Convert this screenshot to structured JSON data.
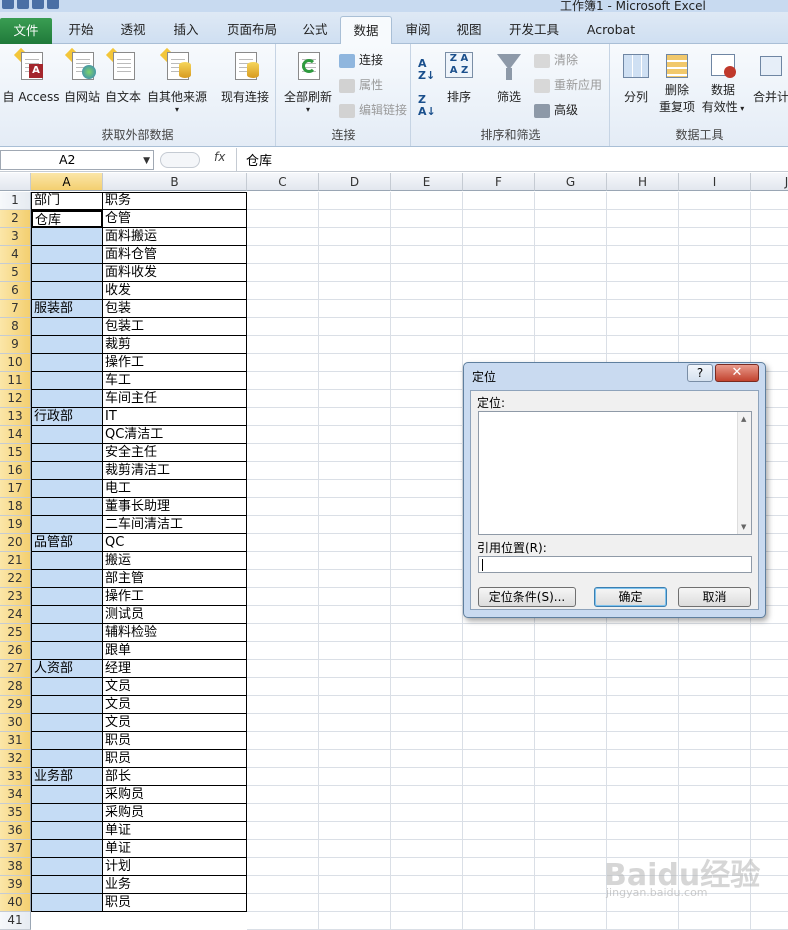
{
  "window": {
    "title": "工作簿1 - Microsoft Excel"
  },
  "tabs": [
    "文件",
    "开始",
    "插入",
    "页面布局",
    "公式",
    "数据",
    "审阅",
    "视图",
    "开发工具",
    "Acrobat"
  ],
  "tabs_display": [
    "文件",
    "开始",
    "透视",
    "插入",
    "页面布局",
    "公式",
    "数据",
    "审阅",
    "视图",
    "开发工具",
    "Acrobat"
  ],
  "active_tab": "数据",
  "ribbon": {
    "external": {
      "label": "获取外部数据",
      "access": "自 Access",
      "web": "自网站",
      "text": "自文本",
      "other": "自其他来源",
      "existing": "现有连接"
    },
    "connections": {
      "label": "连接",
      "refresh_all": "全部刷新",
      "connections": "连接",
      "properties": "属性",
      "edit_links": "编辑链接"
    },
    "sort": {
      "label": "排序和筛选",
      "sort": "排序",
      "filter": "筛选",
      "clear": "清除",
      "reapply": "重新应用",
      "advanced": "高级"
    },
    "tools": {
      "label": "数据工具",
      "split": "分列",
      "remove_dup_1": "删除",
      "remove_dup_2": "重复项",
      "validation_1": "数据",
      "validation_2": "有效性",
      "consolidate": "合并计"
    }
  },
  "formula_bar": {
    "name_box": "A2",
    "fx": "fx",
    "value": "仓库"
  },
  "columns": [
    "A",
    "B",
    "C",
    "D",
    "E",
    "F",
    "G",
    "H",
    "I",
    "J"
  ],
  "rows": [
    {
      "n": "1",
      "a": "部门",
      "b": "职务"
    },
    {
      "n": "2",
      "a": "仓库",
      "b": "仓管"
    },
    {
      "n": "3",
      "a": "",
      "b": "面料搬运"
    },
    {
      "n": "4",
      "a": "",
      "b": "面料仓管"
    },
    {
      "n": "5",
      "a": "",
      "b": "面料收发"
    },
    {
      "n": "6",
      "a": "",
      "b": "收发"
    },
    {
      "n": "7",
      "a": "服装部",
      "b": "包装"
    },
    {
      "n": "8",
      "a": "",
      "b": "包装工"
    },
    {
      "n": "9",
      "a": "",
      "b": "裁剪"
    },
    {
      "n": "10",
      "a": "",
      "b": "操作工"
    },
    {
      "n": "11",
      "a": "",
      "b": "车工"
    },
    {
      "n": "12",
      "a": "",
      "b": "车间主任"
    },
    {
      "n": "13",
      "a": "行政部",
      "b": "IT"
    },
    {
      "n": "14",
      "a": "",
      "b": "QC清洁工"
    },
    {
      "n": "15",
      "a": "",
      "b": "安全主任"
    },
    {
      "n": "16",
      "a": "",
      "b": "裁剪清洁工"
    },
    {
      "n": "17",
      "a": "",
      "b": "电工"
    },
    {
      "n": "18",
      "a": "",
      "b": "董事长助理"
    },
    {
      "n": "19",
      "a": "",
      "b": "二车间清洁工"
    },
    {
      "n": "20",
      "a": "品管部",
      "b": "QC"
    },
    {
      "n": "21",
      "a": "",
      "b": "搬运"
    },
    {
      "n": "22",
      "a": "",
      "b": "部主管"
    },
    {
      "n": "23",
      "a": "",
      "b": "操作工"
    },
    {
      "n": "24",
      "a": "",
      "b": "测试员"
    },
    {
      "n": "25",
      "a": "",
      "b": "辅料检验"
    },
    {
      "n": "26",
      "a": "",
      "b": "跟单"
    },
    {
      "n": "27",
      "a": "人资部",
      "b": "经理"
    },
    {
      "n": "28",
      "a": "",
      "b": "文员"
    },
    {
      "n": "29",
      "a": "",
      "b": "文员"
    },
    {
      "n": "30",
      "a": "",
      "b": "文员"
    },
    {
      "n": "31",
      "a": "",
      "b": "职员"
    },
    {
      "n": "32",
      "a": "",
      "b": "职员"
    },
    {
      "n": "33",
      "a": "业务部",
      "b": "部长"
    },
    {
      "n": "34",
      "a": "",
      "b": "采购员"
    },
    {
      "n": "35",
      "a": "",
      "b": "采购员"
    },
    {
      "n": "36",
      "a": "",
      "b": "单证"
    },
    {
      "n": "37",
      "a": "",
      "b": "单证"
    },
    {
      "n": "38",
      "a": "",
      "b": "计划"
    },
    {
      "n": "39",
      "a": "",
      "b": "业务"
    },
    {
      "n": "40",
      "a": "",
      "b": "职员"
    },
    {
      "n": "41",
      "a": "",
      "b": ""
    }
  ],
  "dialog": {
    "title": "定位",
    "help": "?",
    "close": "✕",
    "goto_label": "定位:",
    "ref_label": "引用位置(R):",
    "special_btn": "定位条件(S)...",
    "ok_btn": "确定",
    "cancel_btn": "取消"
  },
  "watermark": {
    "main": "Baidu经验",
    "sub": "jingyan.baidu.com"
  },
  "colors": {
    "selection": "#c5dcf5",
    "file_tab": "#1f7a3a",
    "header_highlight": "#f3cf70"
  }
}
